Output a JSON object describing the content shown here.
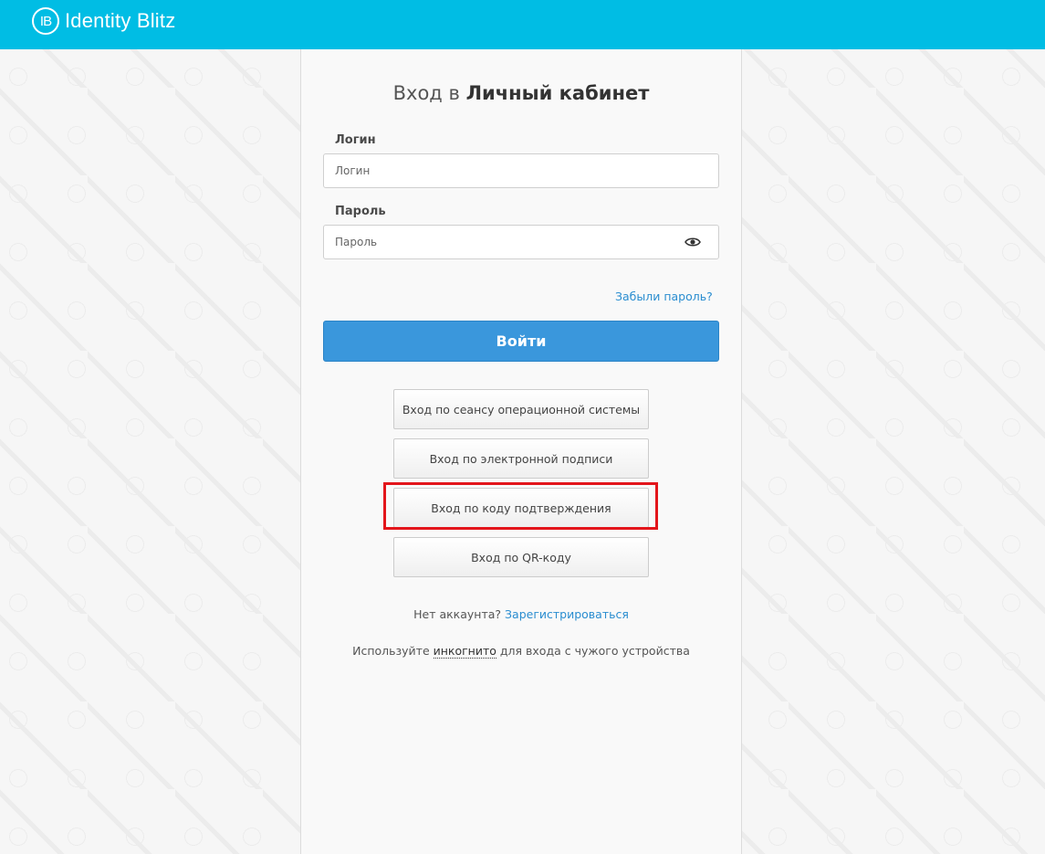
{
  "header": {
    "logo_mark": "IB",
    "brand": "Identity Blitz",
    "bg_color": "#00bde4"
  },
  "form": {
    "title_prefix": "Вход в",
    "title_bold": "Личный кабинет",
    "login_label": "Логин",
    "login_placeholder": "Логин",
    "login_value": "",
    "password_label": "Пароль",
    "password_placeholder": "Пароль",
    "password_value": "",
    "password_toggle_icon": "eye-icon",
    "forgot_link": "Забыли пароль?",
    "submit_label": "Войти",
    "submit_color": "#3a97dc"
  },
  "alt_logins": [
    {
      "label": "Вход по сеансу операционной системы"
    },
    {
      "label": "Вход по электронной подписи"
    },
    {
      "label": "Вход по коду подтверждения",
      "highlighted": true
    },
    {
      "label": "Вход по QR-коду"
    }
  ],
  "highlight_color": "#e3151b",
  "signup": {
    "text": "Нет аккаунта?",
    "link": "Зарегистрироваться"
  },
  "incognito": {
    "before": "Используйте",
    "link": "инкогнито",
    "after": "для входа с чужого устройства"
  }
}
